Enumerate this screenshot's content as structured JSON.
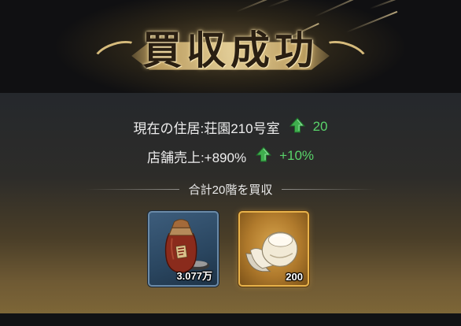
{
  "header": {
    "title": "買収成功"
  },
  "info": {
    "residence_label": "現在の住居:荘園210号室",
    "residence_bonus": "20",
    "sales_label": "店舗売上:+890%",
    "sales_bonus": "+10%"
  },
  "summary": {
    "text": "合計20階を買収"
  },
  "rewards": [
    {
      "icon": "wine-jar-icon",
      "count": "3.077万",
      "rarity_color": "#6a8aa8"
    },
    {
      "icon": "gold-ingot-icon",
      "count": "200",
      "rarity_color": "#e8b24a"
    }
  ],
  "colors": {
    "bonus_green": "#59d36a",
    "title_ink": "#2a1f12",
    "gold": "#e2c784"
  }
}
